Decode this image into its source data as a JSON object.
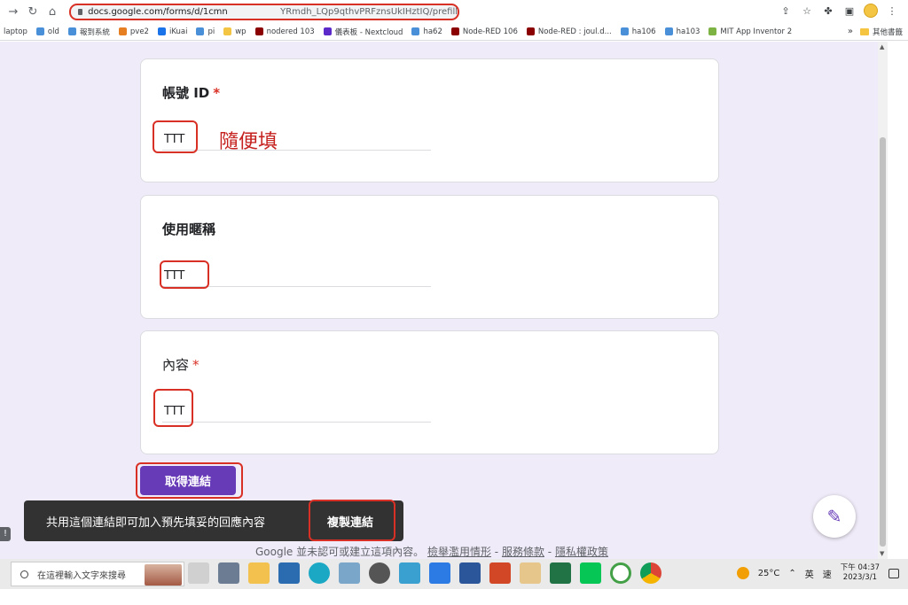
{
  "browser": {
    "url_visible_start": "docs.google.com/forms/d/1cmn",
    "url_visible_end": "YRmdh_LQp9qthvPRFznsUkIHztIQ/prefill"
  },
  "bookmarks": [
    {
      "label": "laptop",
      "color": ""
    },
    {
      "label": "old",
      "color": "#4a90d9"
    },
    {
      "label": "報到系統",
      "color": "#4a90d9"
    },
    {
      "label": "pve2",
      "color": "#e67e22"
    },
    {
      "label": "iKuai",
      "color": "#1a73e8"
    },
    {
      "label": "pi",
      "color": "#4a90d9"
    },
    {
      "label": "wp",
      "color": "#f4c542"
    },
    {
      "label": "nodered 103",
      "color": "#8b0000"
    },
    {
      "label": "儀表板 - Nextcloud",
      "color": "#5b2ac8"
    },
    {
      "label": "ha62",
      "color": "#4a90d9"
    },
    {
      "label": "Node-RED 106",
      "color": "#8b0000"
    },
    {
      "label": "Node-RED : joul.d...",
      "color": "#8b0000"
    },
    {
      "label": "ha106",
      "color": "#4a90d9"
    },
    {
      "label": "ha103",
      "color": "#4a90d9"
    },
    {
      "label": "MIT App Inventor 2",
      "color": "#7cb342"
    }
  ],
  "bookmarks_more": "»",
  "bookmarks_other": "其他書籤",
  "form": {
    "q1": {
      "title": "帳號 ID",
      "required": "*",
      "answer": "TTT"
    },
    "q1_note": "隨便填",
    "q2": {
      "title": "使用暱稱",
      "answer": "TTT"
    },
    "q3": {
      "title": "內容",
      "required": "*",
      "answer": "TTT"
    },
    "get_link_button": "取得連結"
  },
  "snackbar": {
    "text": "共用這個連結即可加入預先填妥的回應內容",
    "action": "複製連結"
  },
  "footer": {
    "text": "Google 並未認可或建立這項內容。",
    "link_abuse": "檢舉濫用情形",
    "sep": " - ",
    "link_terms": "服務條款",
    "link_privacy": "隱私權政策"
  },
  "taskbar": {
    "search_placeholder": "在這裡輸入文字來搜尋",
    "weather": "25°C",
    "ime": "英",
    "ime2": "速",
    "time": "下午 04:37",
    "date": "2023/3/1"
  },
  "colors": {
    "accent": "#673ab7",
    "page_bg": "#f0ebf8",
    "highlight": "#d93025"
  }
}
